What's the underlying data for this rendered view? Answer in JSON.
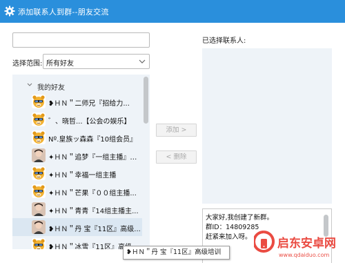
{
  "window": {
    "title": "添加联系人到群--朋友交流",
    "icon": "gear-icon",
    "accent": "#2a8fdc"
  },
  "search": {
    "value": ""
  },
  "scope": {
    "label": "选择范围:",
    "selected": "所有好友"
  },
  "tree": {
    "group_name": "我的好友",
    "contacts": [
      {
        "name": "❥ＨＮ＂二师兄『招给力...",
        "avatar": "tiger",
        "selected": false
      },
      {
        "name": "゛、晓哲...【公会の娱乐】",
        "avatar": "tiger",
        "selected": false
      },
      {
        "name": "Nº.皇族ッ森森『10组会员』",
        "avatar": "tiger",
        "selected": false
      },
      {
        "name": "✦ＨＮ＂追梦『一组主播』B...",
        "avatar": "photo",
        "selected": false
      },
      {
        "name": "✦ＨＮ＂幸福一组主播",
        "avatar": "tiger",
        "selected": false
      },
      {
        "name": "✦ＨＮ＂芒果『００组主播...",
        "avatar": "tiger",
        "selected": false
      },
      {
        "name": "✦ＨＮ＂青青『14组主播主...",
        "avatar": "photo",
        "selected": false
      },
      {
        "name": "❥ＨＮ＂丹 宝『11区』高级...",
        "avatar": "photo",
        "selected": true
      },
      {
        "name": "❥ＨＮ＂冰雪『11区』高级...",
        "avatar": "tiger",
        "selected": false
      }
    ]
  },
  "buttons": {
    "add": "添加 >",
    "remove": "< 删除"
  },
  "selected_panel": {
    "label": "已选择联系人:"
  },
  "message": {
    "line1": "大家好,我创建了新群。",
    "line2": "群ID：14809285",
    "line3": "赶紧来加入呀。"
  },
  "watermark": {
    "text": "启东安卓网",
    "url_text": "www.qdaiduo.com",
    "color": "#e8382e"
  },
  "tooltip": {
    "text": "❥ＨＮ＂丹 宝『11区』高级培训"
  }
}
